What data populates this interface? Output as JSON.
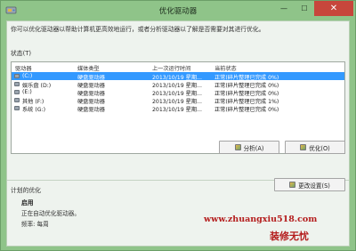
{
  "window": {
    "title": "优化驱动器",
    "controls": {
      "minimize": "—",
      "maximize": "☐",
      "close": "✕"
    }
  },
  "description": "你可以优化驱动器以帮助计算机更高效地运行，或者分析驱动器以了解是否需要对其进行优化。",
  "status_label": "状态(T)",
  "table": {
    "columns": [
      "驱动器",
      "媒体类型",
      "上一次运行时间",
      "当前状态"
    ],
    "rows": [
      {
        "drive": "(C:)",
        "media": "硬盘驱动器",
        "last_run": "2013/10/19 星期...",
        "status": "正常(碎片整理已完成 0%)",
        "selected": true
      },
      {
        "drive": "娱乐盘 (D:)",
        "media": "硬盘驱动器",
        "last_run": "2013/10/19 星期...",
        "status": "正常(碎片整理已完成 0%)",
        "selected": false
      },
      {
        "drive": "(E:)",
        "media": "硬盘驱动器",
        "last_run": "2013/10/19 星期...",
        "status": "正常(碎片整理已完成 0%)",
        "selected": false
      },
      {
        "drive": "其他 (F:)",
        "media": "硬盘驱动器",
        "last_run": "2013/10/19 星期...",
        "status": "正常(碎片整理已完成 1%)",
        "selected": false
      },
      {
        "drive": "系统 (G:)",
        "media": "硬盘驱动器",
        "last_run": "2013/10/19 星期...",
        "status": "正常(碎片整理已完成 0%)",
        "selected": false
      }
    ]
  },
  "buttons": {
    "analyze": "分析(A)",
    "optimize": "优化(O)",
    "change_settings": "更改设置(S)"
  },
  "schedule": {
    "label": "计划的优化",
    "status": "启用",
    "description": "正在自动优化驱动器。",
    "frequency": "频率: 每周"
  },
  "watermark": {
    "url": "www.zhuangxiu518.com",
    "name": "装修无忧"
  },
  "colors": {
    "frame": "#8fc489",
    "selection": "#3399ff",
    "close": "#c7463c",
    "watermark": "#b41c1c"
  }
}
